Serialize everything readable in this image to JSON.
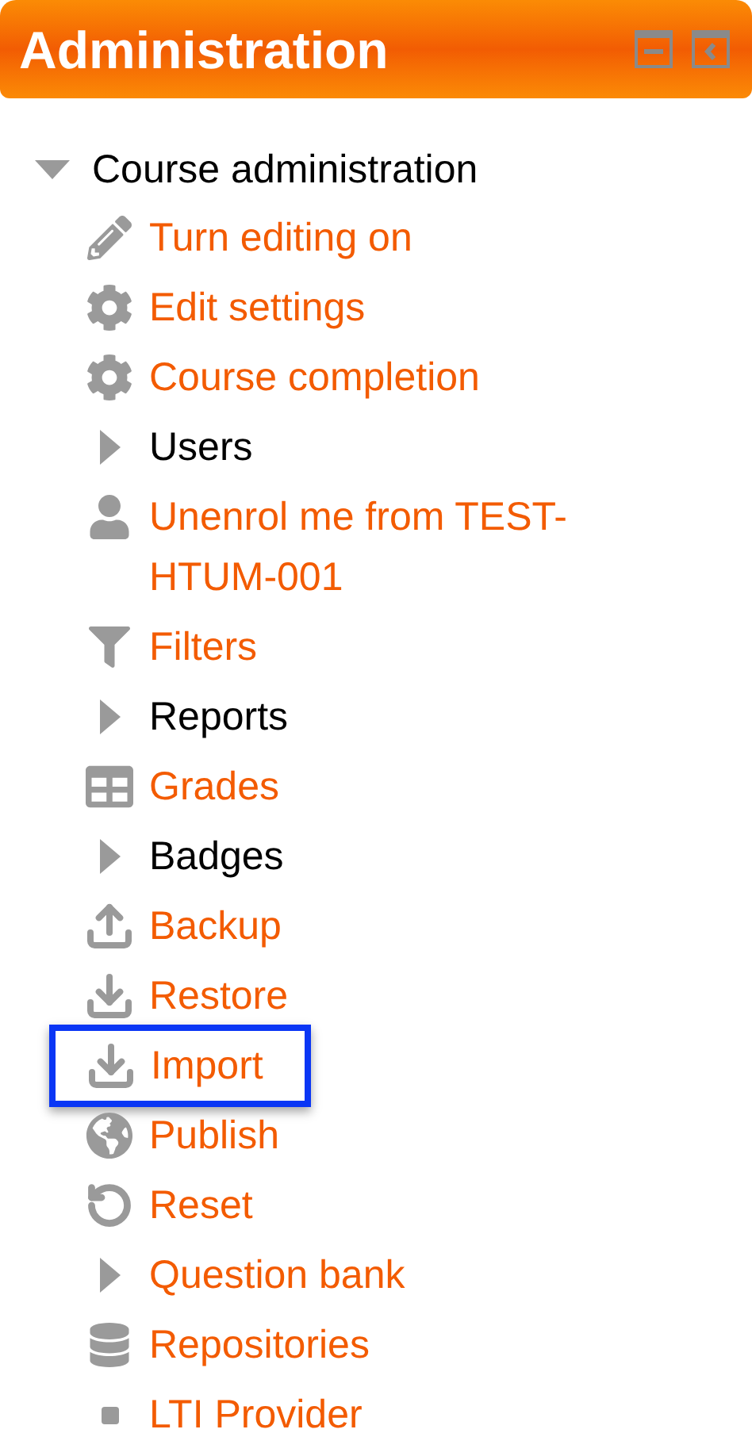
{
  "block": {
    "title": "Administration",
    "controls": [
      {
        "kind": "minimize"
      },
      {
        "kind": "dock"
      }
    ]
  },
  "tree": {
    "label": "Course administration",
    "expanded": true,
    "children": [
      {
        "kind": "edit",
        "label": "Turn editing on",
        "link": true,
        "highlighted": false
      },
      {
        "kind": "settings",
        "label": "Edit settings",
        "link": true,
        "highlighted": false
      },
      {
        "kind": "settings",
        "label": "Course completion",
        "link": true,
        "highlighted": false
      },
      {
        "kind": "branch",
        "label": "Users",
        "link": false,
        "expanded": false,
        "highlighted": false
      },
      {
        "kind": "user",
        "label": "Unenrol me from TEST-HTUM-001",
        "link": true,
        "highlighted": false
      },
      {
        "kind": "filter",
        "label": "Filters",
        "link": true,
        "highlighted": false
      },
      {
        "kind": "branch",
        "label": "Reports",
        "link": false,
        "expanded": false,
        "highlighted": false
      },
      {
        "kind": "grades",
        "label": "Grades",
        "link": true,
        "highlighted": false
      },
      {
        "kind": "branch",
        "label": "Badges",
        "link": false,
        "expanded": false,
        "highlighted": false
      },
      {
        "kind": "backup",
        "label": "Backup",
        "link": true,
        "highlighted": false
      },
      {
        "kind": "restore",
        "label": "Restore",
        "link": true,
        "highlighted": false
      },
      {
        "kind": "restore",
        "label": "Import",
        "link": true,
        "highlighted": true
      },
      {
        "kind": "publish",
        "label": "Publish",
        "link": true,
        "highlighted": false
      },
      {
        "kind": "reset",
        "label": "Reset",
        "link": true,
        "highlighted": false
      },
      {
        "kind": "branch",
        "label": "Question bank",
        "link": true,
        "expanded": false,
        "highlighted": false
      },
      {
        "kind": "repository",
        "label": "Repositories",
        "link": true,
        "highlighted": false
      },
      {
        "kind": "leaf",
        "label": "LTI Provider",
        "link": true,
        "highlighted": false
      }
    ]
  }
}
